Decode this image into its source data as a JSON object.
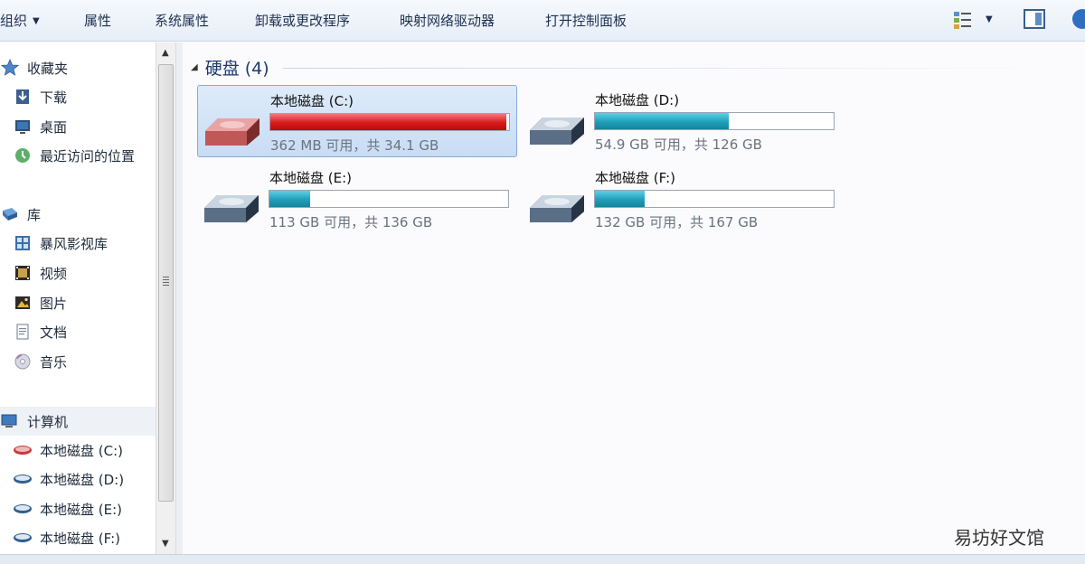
{
  "toolbar": {
    "organize": "组织",
    "items": [
      "属性",
      "系统属性",
      "卸载或更改程序",
      "映射网络驱动器",
      "打开控制面板"
    ]
  },
  "sidebar": {
    "favorites": {
      "label": "收藏夹",
      "icon": "star-icon",
      "items": [
        {
          "label": "下载",
          "icon": "download-icon"
        },
        {
          "label": "桌面",
          "icon": "desktop-icon"
        },
        {
          "label": "最近访问的位置",
          "icon": "recent-places-icon"
        }
      ]
    },
    "libraries": {
      "label": "库",
      "icon": "library-icon",
      "items": [
        {
          "label": "暴风影视库",
          "icon": "media-library-icon"
        },
        {
          "label": "视频",
          "icon": "video-icon"
        },
        {
          "label": "图片",
          "icon": "pictures-icon"
        },
        {
          "label": "文档",
          "icon": "documents-icon"
        },
        {
          "label": "音乐",
          "icon": "music-icon"
        }
      ]
    },
    "computer": {
      "label": "计算机",
      "icon": "computer-icon",
      "items": [
        {
          "label": "本地磁盘 (C:)",
          "icon": "drive-icon"
        },
        {
          "label": "本地磁盘 (D:)",
          "icon": "drive-icon"
        },
        {
          "label": "本地磁盘 (E:)",
          "icon": "drive-icon"
        },
        {
          "label": "本地磁盘 (F:)",
          "icon": "drive-icon"
        }
      ]
    }
  },
  "main": {
    "section_title": "硬盘 (4)",
    "drives": [
      {
        "label": "本地磁盘 (C:)",
        "info": "362 MB 可用，共 34.1 GB",
        "used_fraction": 0.99,
        "bar_color": "#d61a1a",
        "selected": true
      },
      {
        "label": "本地磁盘 (D:)",
        "info": "54.9 GB 可用，共 126 GB",
        "used_fraction": 0.56,
        "bar_color": "#1f9fba",
        "selected": false
      },
      {
        "label": "本地磁盘 (E:)",
        "info": "113 GB 可用，共 136 GB",
        "used_fraction": 0.17,
        "bar_color": "#1f9fba",
        "selected": false
      },
      {
        "label": "本地磁盘 (F:)",
        "info": "132 GB 可用，共 167 GB",
        "used_fraction": 0.21,
        "bar_color": "#1f9fba",
        "selected": false
      }
    ]
  },
  "colors": {
    "toolbar_bg": "#e6eef8",
    "selection_bg": "#c8dcf4",
    "bar_full": "#d61a1a",
    "bar_normal": "#1f9fba"
  },
  "watermark": "易坊好文馆"
}
